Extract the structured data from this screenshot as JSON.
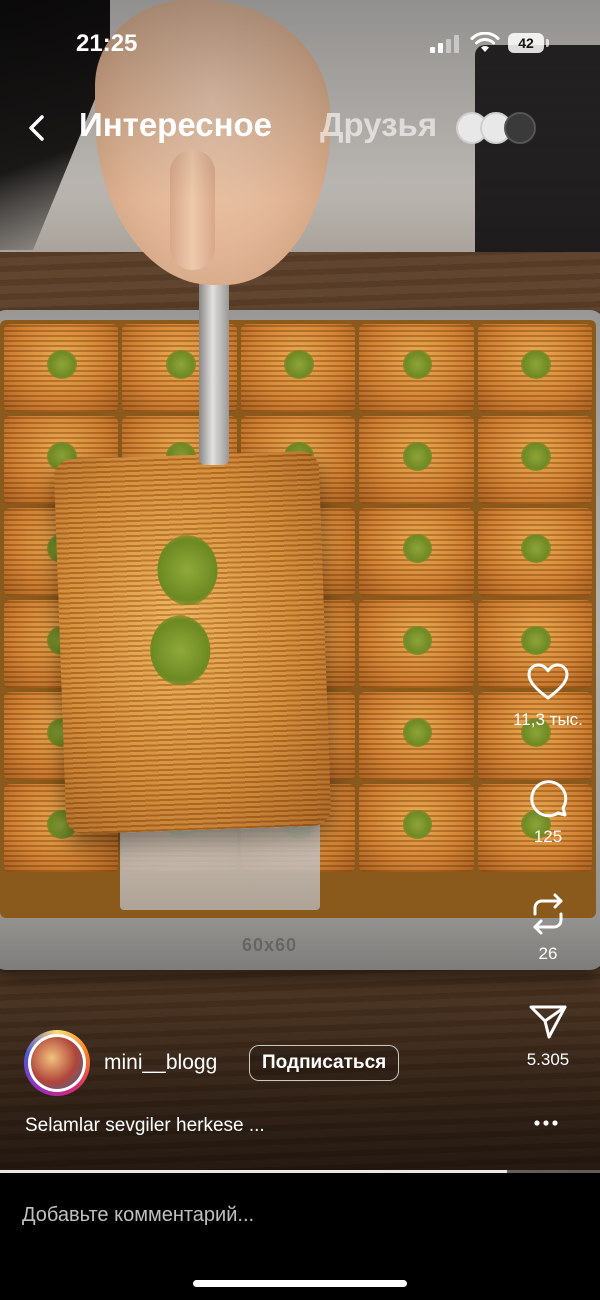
{
  "status_bar": {
    "time": "21:25",
    "battery": "42"
  },
  "header": {
    "tab_active": "Интересное",
    "tab_inactive": "Друзья"
  },
  "actions": {
    "likes": "11,3 тыс.",
    "comments": "125",
    "reposts": "26",
    "shares": "5.305"
  },
  "author": {
    "username": "mini__blogg",
    "follow_label": "Подписаться"
  },
  "caption": "Selamlar sevgiler herkese ...",
  "video": {
    "tray_stamp": "60x60",
    "progress": 0.845
  },
  "comment_bar": {
    "placeholder": "Добавьте комментарий..."
  },
  "icons": {
    "back": "chevron-left-icon",
    "like": "heart-icon",
    "comment": "comment-bubble-icon",
    "repost": "repost-icon",
    "share": "paper-plane-icon",
    "more": "more-dots-icon"
  }
}
